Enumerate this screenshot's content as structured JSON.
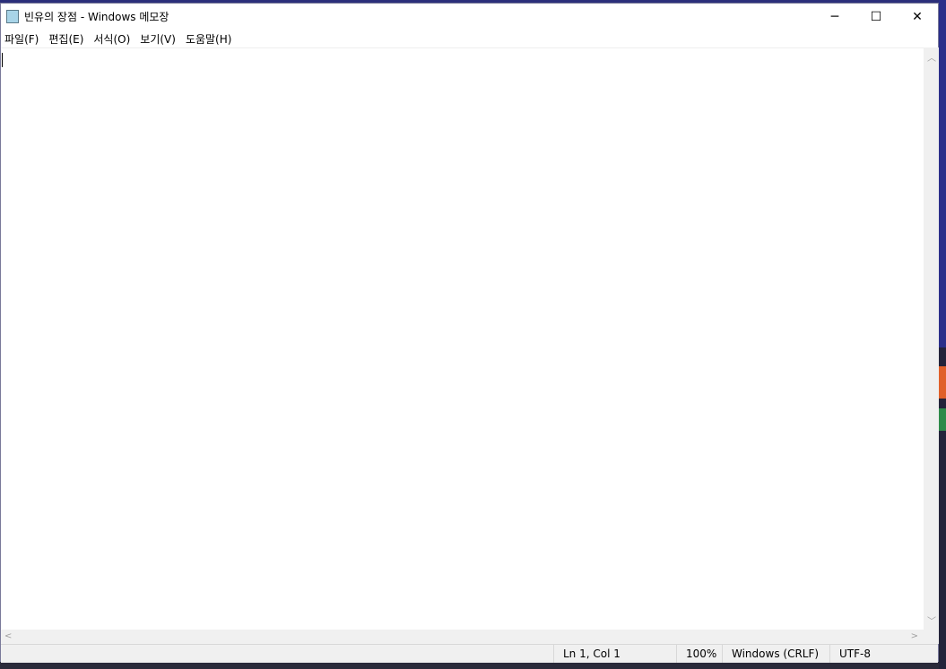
{
  "window": {
    "title": "빈유의 장점 - Windows 메모장",
    "controls": {
      "minimize": "─",
      "maximize": "☐",
      "close": "✕"
    }
  },
  "menu": [
    "파일(F)",
    "편집(E)",
    "서식(O)",
    "보기(V)",
    "도움말(H)"
  ],
  "editor": {
    "content": ""
  },
  "status": {
    "position": "Ln 1, Col 1",
    "zoom": "100%",
    "line_ending": "Windows (CRLF)",
    "encoding": "UTF-8"
  }
}
